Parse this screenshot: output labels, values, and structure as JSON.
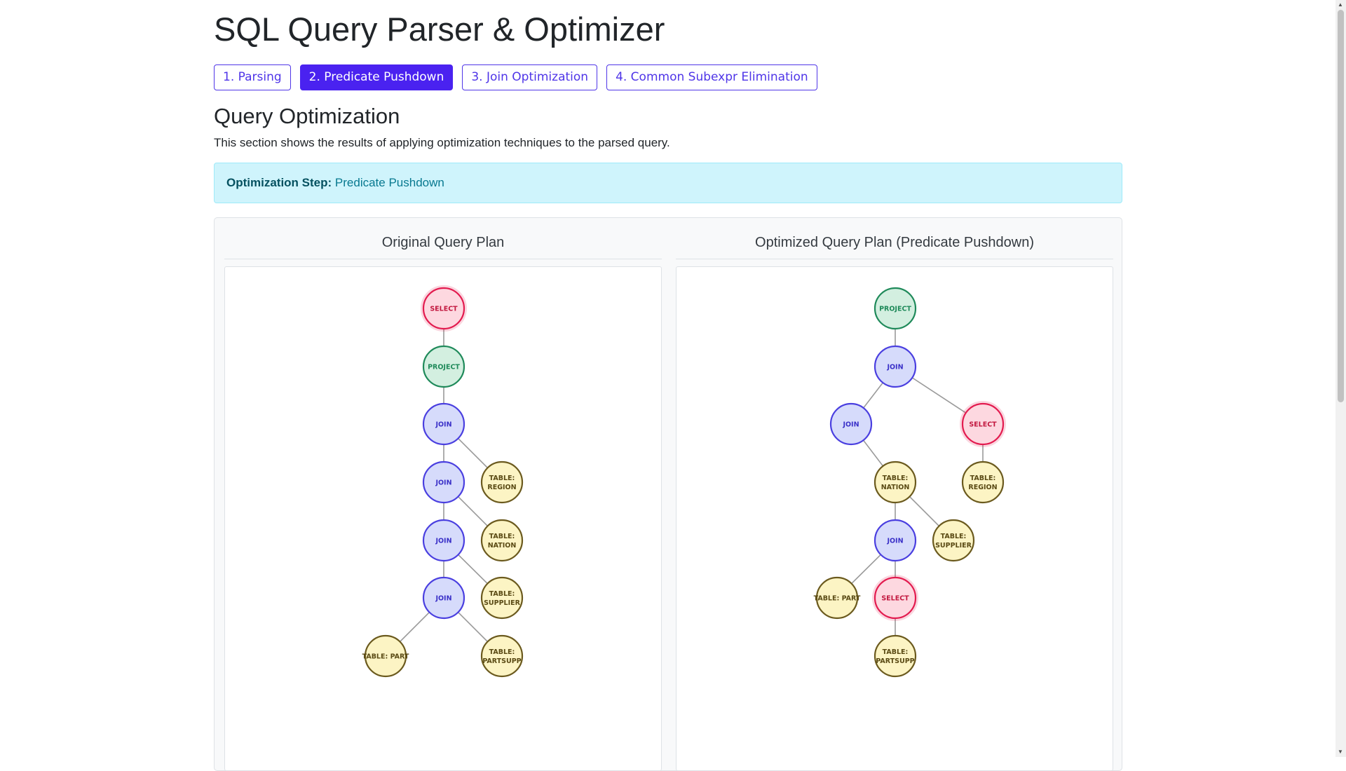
{
  "title": "SQL Query Parser & Optimizer",
  "tabs": [
    {
      "label": "1. Parsing",
      "active": false
    },
    {
      "label": "2. Predicate Pushdown",
      "active": true
    },
    {
      "label": "3. Join Optimization",
      "active": false
    },
    {
      "label": "4. Common Subexpr Elimination",
      "active": false
    }
  ],
  "section": {
    "title": "Query Optimization",
    "description": "This section shows the results of applying optimization techniques to the parsed query."
  },
  "alert": {
    "label": "Optimization Step:",
    "value": "Predicate Pushdown"
  },
  "colors": {
    "select": {
      "fill": "#fdd8e0",
      "stroke": "#e31b4f",
      "text": "#c2183f"
    },
    "project": {
      "fill": "#d3efe0",
      "stroke": "#1f8a5a",
      "text": "#1f8a5a"
    },
    "join": {
      "fill": "#d6dbfb",
      "stroke": "#4a3fe0",
      "text": "#3a30c8"
    },
    "table": {
      "fill": "#fcf4c4",
      "stroke": "#6b5a1e",
      "text": "#5a4a14"
    }
  },
  "plans": [
    {
      "title": "Original Query Plan",
      "nodes": [
        {
          "id": "s1",
          "type": "select",
          "label": [
            "SELECT"
          ]
        },
        {
          "id": "p1",
          "type": "project",
          "label": [
            "PROJECT"
          ]
        },
        {
          "id": "j1",
          "type": "join",
          "label": [
            "JOIN"
          ]
        },
        {
          "id": "j2",
          "type": "join",
          "label": [
            "JOIN"
          ]
        },
        {
          "id": "tr",
          "type": "table",
          "label": [
            "TABLE:",
            "REGION"
          ]
        },
        {
          "id": "j3",
          "type": "join",
          "label": [
            "JOIN"
          ]
        },
        {
          "id": "tn",
          "type": "table",
          "label": [
            "TABLE:",
            "NATION"
          ]
        },
        {
          "id": "j4",
          "type": "join",
          "label": [
            "JOIN"
          ]
        },
        {
          "id": "ts",
          "type": "table",
          "label": [
            "TABLE:",
            "SUPPLIER"
          ]
        },
        {
          "id": "tp",
          "type": "table",
          "label": [
            "TABLE: PART"
          ]
        },
        {
          "id": "tps",
          "type": "table",
          "label": [
            "TABLE:",
            "PARTSUPP"
          ]
        }
      ],
      "edges": [
        [
          "s1",
          "p1"
        ],
        [
          "p1",
          "j1"
        ],
        [
          "j1",
          "j2"
        ],
        [
          "j1",
          "tr"
        ],
        [
          "j2",
          "j3"
        ],
        [
          "j2",
          "tn"
        ],
        [
          "j3",
          "j4"
        ],
        [
          "j3",
          "ts"
        ],
        [
          "j4",
          "tp"
        ],
        [
          "j4",
          "tps"
        ]
      ]
    },
    {
      "title": "Optimized Query Plan (Predicate Pushdown)",
      "nodes": [
        {
          "id": "p1",
          "type": "project",
          "label": [
            "PROJECT"
          ]
        },
        {
          "id": "j1",
          "type": "join",
          "label": [
            "JOIN"
          ]
        },
        {
          "id": "j2",
          "type": "join",
          "label": [
            "JOIN"
          ]
        },
        {
          "id": "s1",
          "type": "select",
          "label": [
            "SELECT"
          ]
        },
        {
          "id": "tn",
          "type": "table",
          "label": [
            "TABLE:",
            "NATION"
          ]
        },
        {
          "id": "tr",
          "type": "table",
          "label": [
            "TABLE:",
            "REGION"
          ]
        },
        {
          "id": "j3",
          "type": "join",
          "label": [
            "JOIN"
          ]
        },
        {
          "id": "ts",
          "type": "table",
          "label": [
            "TABLE:",
            "SUPPLIER"
          ]
        },
        {
          "id": "tp",
          "type": "table",
          "label": [
            "TABLE: PART"
          ]
        },
        {
          "id": "s2",
          "type": "select",
          "label": [
            "SELECT"
          ]
        },
        {
          "id": "tps",
          "type": "table",
          "label": [
            "TABLE:",
            "PARTSUPP"
          ]
        }
      ],
      "edges": [
        [
          "p1",
          "j1"
        ],
        [
          "j1",
          "j2"
        ],
        [
          "j1",
          "s1"
        ],
        [
          "j2",
          "tn"
        ],
        [
          "s1",
          "tr"
        ],
        [
          "tn",
          "j3"
        ],
        [
          "tn",
          "ts"
        ],
        [
          "j3",
          "tp"
        ],
        [
          "j3",
          "s2"
        ],
        [
          "s2",
          "tps"
        ]
      ]
    }
  ]
}
